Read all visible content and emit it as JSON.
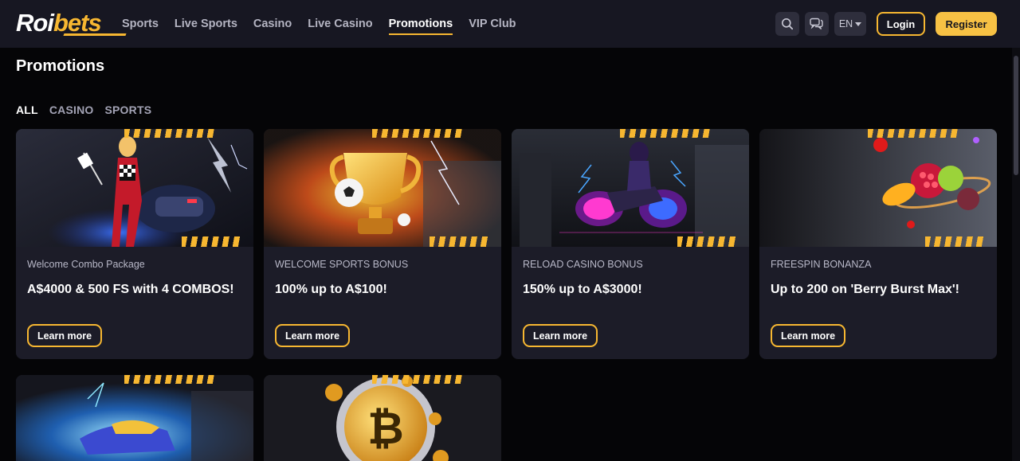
{
  "brand": {
    "name_part1": "Roi",
    "name_part2": "bets"
  },
  "nav": {
    "items": [
      {
        "label": "Sports"
      },
      {
        "label": "Live Sports"
      },
      {
        "label": "Casino"
      },
      {
        "label": "Live Casino"
      },
      {
        "label": "Promotions",
        "active": true
      },
      {
        "label": "VIP Club"
      }
    ]
  },
  "header": {
    "search_icon": "search-icon",
    "chat_icon": "chat-icon",
    "language": "EN",
    "login_label": "Login",
    "register_label": "Register"
  },
  "page": {
    "title": "Promotions",
    "filters": [
      {
        "label": "ALL",
        "active": true
      },
      {
        "label": "CASINO"
      },
      {
        "label": "SPORTS"
      }
    ]
  },
  "promotions": [
    {
      "category": "Welcome Combo Package",
      "title": "A$4000 & 500 FS with 4 COMBOS!",
      "cta": "Learn more"
    },
    {
      "category": "WELCOME SPORTS BONUS",
      "title": "100% up to A$100!",
      "cta": "Learn more"
    },
    {
      "category": "RELOAD CASINO BONUS",
      "title": "150% up to A$3000!",
      "cta": "Learn more"
    },
    {
      "category": "FREESPIN BONANZA",
      "title": "Up to 200 on 'Berry Burst Max'!",
      "cta": "Learn more"
    }
  ],
  "colors": {
    "accent": "#f7b731",
    "header_bg": "#171722",
    "page_bg": "#050507",
    "card_bg": "#1c1c28"
  }
}
